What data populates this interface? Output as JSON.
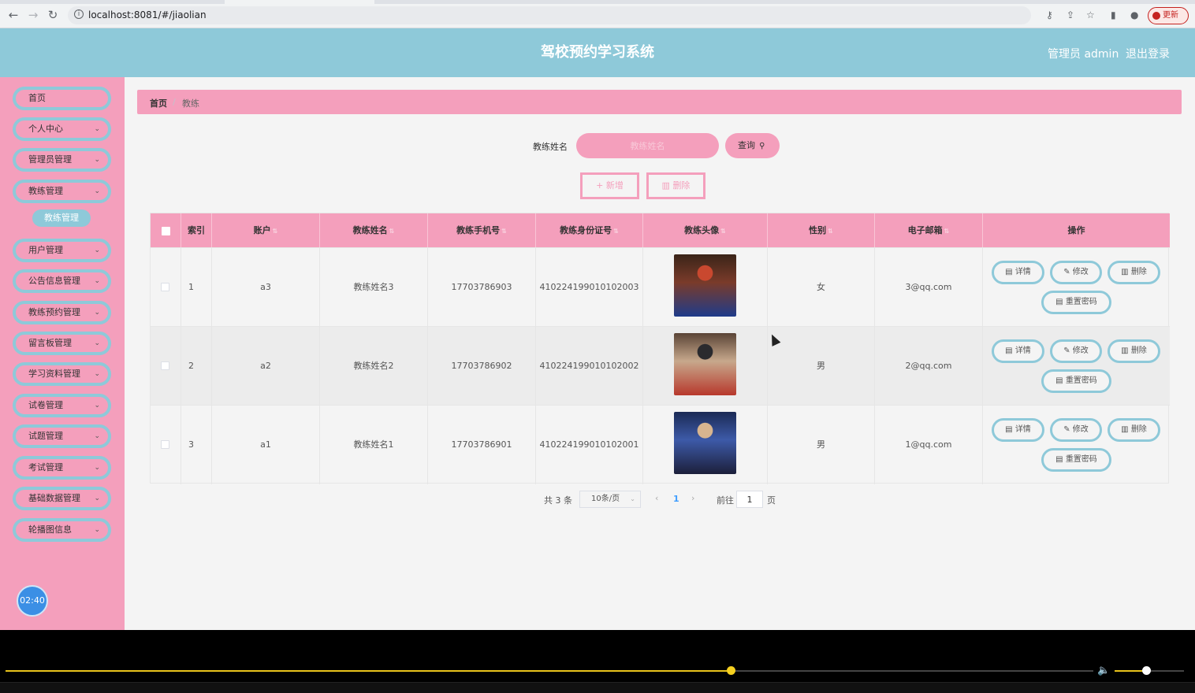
{
  "browser": {
    "url": "localhost:8081/#/jiaolian",
    "update_label": "更新"
  },
  "header": {
    "title": "驾校预约学习系统",
    "admin": "管理员 admin",
    "logout": "退出登录"
  },
  "sidebar": {
    "items": [
      {
        "label": "首页",
        "chevron": false
      },
      {
        "label": "个人中心",
        "chevron": true
      },
      {
        "label": "管理员管理",
        "chevron": true
      },
      {
        "label": "教练管理",
        "chevron": true
      },
      {
        "label": "用户管理",
        "chevron": true
      },
      {
        "label": "公告信息管理",
        "chevron": true
      },
      {
        "label": "教练预约管理",
        "chevron": true
      },
      {
        "label": "留言板管理",
        "chevron": true
      },
      {
        "label": "学习资料管理",
        "chevron": true
      },
      {
        "label": "试卷管理",
        "chevron": true
      },
      {
        "label": "试题管理",
        "chevron": true
      },
      {
        "label": "考试管理",
        "chevron": true
      },
      {
        "label": "基础数据管理",
        "chevron": true
      },
      {
        "label": "轮播图信息",
        "chevron": true
      }
    ],
    "sub_item": "教练管理",
    "clock": "02:40"
  },
  "breadcrumb": {
    "home": "首页",
    "separator": "/",
    "current": "教练"
  },
  "search": {
    "label": "教练姓名",
    "placeholder": "教练姓名",
    "button": "查询"
  },
  "actions": {
    "add": "+ 新增",
    "delete": "删除"
  },
  "table": {
    "headers": {
      "index": "索引",
      "account": "账户",
      "name": "教练姓名",
      "phone": "教练手机号",
      "id_card": "教练身份证号",
      "avatar": "教练头像",
      "gender": "性别",
      "email": "电子邮箱",
      "ops": "操作"
    },
    "rows": [
      {
        "index": "1",
        "account": "a3",
        "name": "教练姓名3",
        "phone": "17703786903",
        "id_card": "410224199010102003",
        "gender": "女",
        "email": "3@qq.com",
        "avatar_colors": [
          "#3a2418",
          "#7a3b2a",
          "#c9482f",
          "#1f3b8a"
        ]
      },
      {
        "index": "2",
        "account": "a2",
        "name": "教练姓名2",
        "phone": "17703786902",
        "id_card": "410224199010102002",
        "gender": "男",
        "email": "2@qq.com",
        "avatar_colors": [
          "#5a4436",
          "#c7a88c",
          "#2a2a2e",
          "#b7382c"
        ]
      },
      {
        "index": "3",
        "account": "a1",
        "name": "教练姓名1",
        "phone": "17703786901",
        "id_card": "410224199010102001",
        "gender": "男",
        "email": "1@qq.com",
        "avatar_colors": [
          "#1b2a55",
          "#3d5aa8",
          "#d8b58f",
          "#1c1f3a"
        ]
      }
    ],
    "row_buttons": {
      "detail": "详情",
      "edit": "修改",
      "delete": "删除",
      "reset": "重置密码"
    }
  },
  "pagination": {
    "total": "共 3 条",
    "page_size": "10条/页",
    "prev": "‹",
    "current_page": "1",
    "next": "›",
    "goto_label": "前往",
    "goto_value": "1",
    "unit": "页"
  },
  "player": {
    "progress": 0.667,
    "volume": 0.45
  },
  "colors": {
    "header": "#8ec9d9",
    "sidebar": "#f49fbc",
    "accent": "#f49fbc",
    "teal": "#8ec9d9"
  }
}
